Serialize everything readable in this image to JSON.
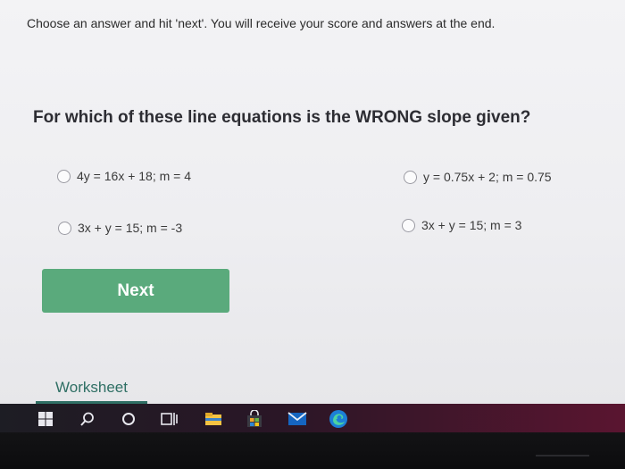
{
  "quiz": {
    "instructions": "Choose an answer and hit 'next'. You will receive your score and answers at the end.",
    "question": "For which of these line equations is the WRONG slope given?",
    "options": [
      {
        "label": "4y = 16x + 18; m = 4"
      },
      {
        "label": "y = 0.75x + 2; m = 0.75"
      },
      {
        "label": "3x + y = 15; m = -3"
      },
      {
        "label": "3x + y = 15; m = 3"
      }
    ],
    "next_label": "Next"
  },
  "tabs": {
    "worksheet_label": "Worksheet"
  },
  "colors": {
    "next_button": "#5aaa7c",
    "worksheet_tab": "#2f6f64",
    "edge_blue": "#1c7fd6",
    "mail_blue": "#1565c0",
    "store_orange": "#f0a32a",
    "file_explorer_yellow": "#f5c342"
  },
  "taskbar": {
    "icons": [
      "windows-start-icon",
      "search-icon",
      "cortana-icon",
      "task-view-icon",
      "file-explorer-icon",
      "microsoft-store-icon",
      "mail-icon",
      "edge-icon"
    ]
  }
}
